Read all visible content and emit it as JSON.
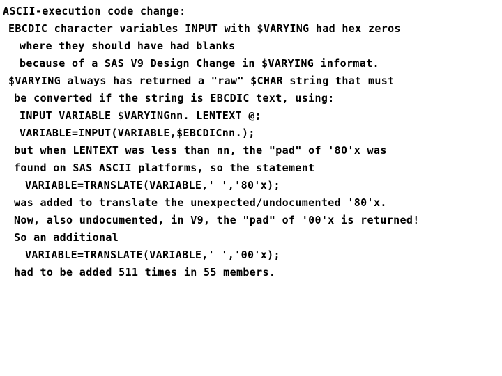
{
  "slide": {
    "title": "ASCII-execution code change:",
    "text_color": "#000000",
    "background_color": "#ffffff",
    "lines": [
      {
        "text": "ASCII-execution code change:",
        "indent": 0
      },
      {
        "text": "EBCDIC character variables INPUT with $VARYING had hex zeros",
        "indent": 1
      },
      {
        "text": "where they should have had blanks",
        "indent": 3
      },
      {
        "text": "because of a SAS V9 Design Change in $VARYING informat.",
        "indent": 3
      },
      {
        "text": "$VARYING always has returned a \"raw\" $CHAR string that must",
        "indent": 1
      },
      {
        "text": "be converted if the string is EBCDIC text, using:",
        "indent": 2
      },
      {
        "text": "INPUT VARIABLE $VARYINGnn. LENTEXT @;",
        "indent": 3
      },
      {
        "text": "VARIABLE=INPUT(VARIABLE,$EBCDICnn.);",
        "indent": 3
      },
      {
        "text": "but when LENTEXT was less than nn, the \"pad\" of '80'x was",
        "indent": 2
      },
      {
        "text": "found on SAS ASCII platforms, so the statement",
        "indent": 2
      },
      {
        "text": "VARIABLE=TRANSLATE(VARIABLE,' ','80'x);",
        "indent": 4
      },
      {
        "text": "was added to translate the unexpected/undocumented '80'x.",
        "indent": 2
      },
      {
        "text": "Now, also undocumented, in V9, the \"pad\" of '00'x is returned!",
        "indent": 2
      },
      {
        "text": "So an additional",
        "indent": 2
      },
      {
        "text": "VARIABLE=TRANSLATE(VARIABLE,' ','00'x);",
        "indent": 4
      },
      {
        "text": "had to be added 511 times in 55 members.",
        "indent": 2
      }
    ]
  }
}
